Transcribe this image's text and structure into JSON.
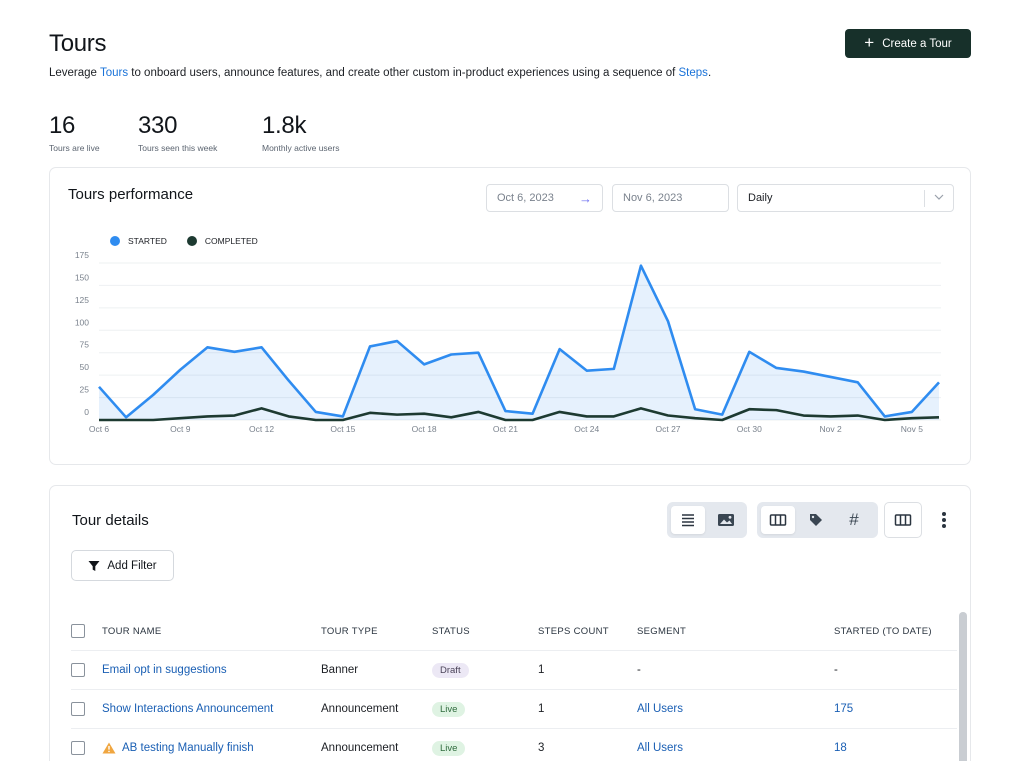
{
  "header": {
    "title": "Tours",
    "intro_before": "Leverage ",
    "intro_link1": "Tours",
    "intro_middle": " to onboard users, announce features, and create other custom in-product experiences using a sequence of ",
    "intro_link2": "Steps",
    "intro_after": ".",
    "create_button": "Create a Tour"
  },
  "stats": [
    {
      "value": "16",
      "label": "Tours are live"
    },
    {
      "value": "330",
      "label": "Tours seen this week"
    },
    {
      "value": "1.8k",
      "label": "Monthly active users"
    }
  ],
  "performance": {
    "title": "Tours performance",
    "start_date": "Oct 6, 2023",
    "end_date": "Nov 6, 2023",
    "granularity": "Daily"
  },
  "chart_data": {
    "type": "area",
    "title": "",
    "xlabel": "",
    "ylabel": "",
    "ylim": [
      0,
      175
    ],
    "yticks": [
      0,
      25,
      50,
      75,
      100,
      125,
      150,
      175
    ],
    "x": [
      "Oct 6",
      "Oct 7",
      "Oct 8",
      "Oct 9",
      "Oct 10",
      "Oct 11",
      "Oct 12",
      "Oct 13",
      "Oct 14",
      "Oct 15",
      "Oct 16",
      "Oct 17",
      "Oct 18",
      "Oct 19",
      "Oct 20",
      "Oct 21",
      "Oct 22",
      "Oct 23",
      "Oct 24",
      "Oct 25",
      "Oct 26",
      "Oct 27",
      "Oct 28",
      "Oct 29",
      "Oct 30",
      "Oct 31",
      "Nov 1",
      "Nov 2",
      "Nov 3",
      "Nov 4",
      "Nov 5",
      "Nov 6"
    ],
    "xtick_labels": [
      "Oct 6",
      "Oct 9",
      "Oct 12",
      "Oct 15",
      "Oct 18",
      "Oct 21",
      "Oct 24",
      "Oct 27",
      "Oct 30",
      "Nov 2",
      "Nov 5"
    ],
    "grid": true,
    "legend_position": "top-left",
    "series": [
      {
        "name": "STARTED",
        "color": "#2f8cf0",
        "values": [
          37,
          3,
          28,
          56,
          81,
          76,
          81,
          44,
          9,
          4,
          82,
          88,
          62,
          73,
          75,
          10,
          7,
          79,
          55,
          57,
          172,
          110,
          12,
          6,
          76,
          58,
          54,
          48,
          42,
          4,
          9,
          42
        ]
      },
      {
        "name": "COMPLETED",
        "color": "#1d3a31",
        "values": [
          0,
          0,
          0,
          2,
          4,
          5,
          13,
          4,
          0,
          0,
          8,
          6,
          7,
          3,
          9,
          0,
          0,
          9,
          4,
          4,
          13,
          5,
          2,
          0,
          12,
          11,
          5,
          4,
          5,
          0,
          2,
          3
        ]
      }
    ]
  },
  "details": {
    "title": "Tour details",
    "filter_button": "Add Filter",
    "columns": [
      "TOUR NAME",
      "TOUR TYPE",
      "STATUS",
      "STEPS COUNT",
      "SEGMENT",
      "STARTED (TO DATE)"
    ],
    "rows": [
      {
        "name": "Email opt in suggestions",
        "type": "Banner",
        "status": "Draft",
        "steps": "1",
        "segment": "-",
        "started": "-",
        "warning": false
      },
      {
        "name": "Show Interactions Announcement",
        "type": "Announcement",
        "status": "Live",
        "steps": "1",
        "segment": "All Users",
        "started": "175",
        "warning": false
      },
      {
        "name": "AB testing Manually finish",
        "type": "Announcement",
        "status": "Live",
        "steps": "3",
        "segment": "All Users",
        "started": "18",
        "warning": true
      }
    ]
  },
  "icons": {
    "create": "plus-icon",
    "date_arrow": "arrow-right-icon",
    "select": "chevron-down-icon",
    "view_list": "list-icon",
    "view_image": "image-icon",
    "columns": "columns-icon",
    "tag": "tag-icon",
    "hash": "hash-icon",
    "more": "kebab-icon",
    "filter": "filter-icon",
    "warning": "warning-icon"
  }
}
